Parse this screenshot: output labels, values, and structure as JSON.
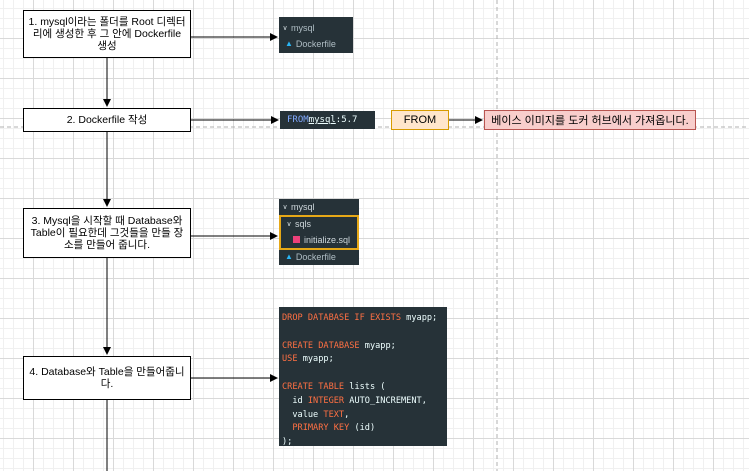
{
  "steps": [
    {
      "text": "1. mysql이라는 폴더를 Root 디렉터리에 생성한 후 그 안에 Dockerfile 생성"
    },
    {
      "text": "2. Dockerfile 작성"
    },
    {
      "text": "3. Mysql을 시작할 때 Database와 Table이 필요한데 그것들을 만들 장소를 만들어 줍니다."
    },
    {
      "text": "4. Database와 Table을 만들어줍니다."
    }
  ],
  "explorer1": {
    "folder": "mysql",
    "file": "Dockerfile"
  },
  "from_code": {
    "kw": "FROM",
    "image": "mysql",
    "sep": ":",
    "tag": "5.7"
  },
  "from_label": "FROM",
  "note": "베이스 이미지를 도커 허브에서 가져옵니다.",
  "explorer2": {
    "folder": "mysql",
    "subfolder": "sqls",
    "sqlfile": "initialize.sql",
    "file": "Dockerfile"
  },
  "sql": {
    "l1k": "DROP DATABASE IF EXISTS",
    "l1v": " myapp;",
    "l2k": "CREATE DATABASE",
    "l2v": " myapp;",
    "l3k": "USE",
    "l3v": " myapp;",
    "l4k": "CREATE TABLE",
    "l4v": " lists (",
    "l5a": "  id ",
    "l5k": "INTEGER",
    "l5v": " AUTO_INCREMENT,",
    "l6a": "  value ",
    "l6k": "TEXT",
    "l6v": ",",
    "l7a": "  ",
    "l7k": "PRIMARY KEY",
    "l7v": " (id)",
    "l8": ");"
  },
  "colors": {
    "accent_highlight": "#e6a817",
    "code_bg": "#263238",
    "keyword": "#ff7043"
  }
}
